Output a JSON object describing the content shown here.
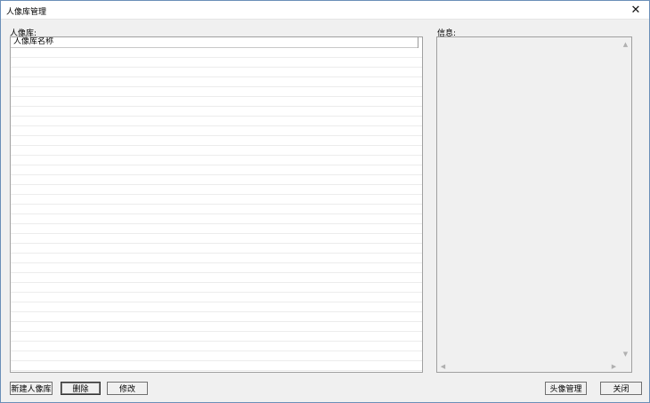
{
  "window": {
    "title": "人像库管理",
    "close_glyph": "✕"
  },
  "library_panel": {
    "label": "人像库:",
    "columns": [
      "人像库名称"
    ],
    "rows": []
  },
  "info_panel": {
    "label": "信息:",
    "content": ""
  },
  "buttons": {
    "new_library": "新建人像库",
    "delete": "删除",
    "modify": "修改",
    "face_manage": "头像管理",
    "close": "关闭"
  },
  "scroll_icons": {
    "up": "▲",
    "down": "▼",
    "left": "◀",
    "right": "▶"
  }
}
